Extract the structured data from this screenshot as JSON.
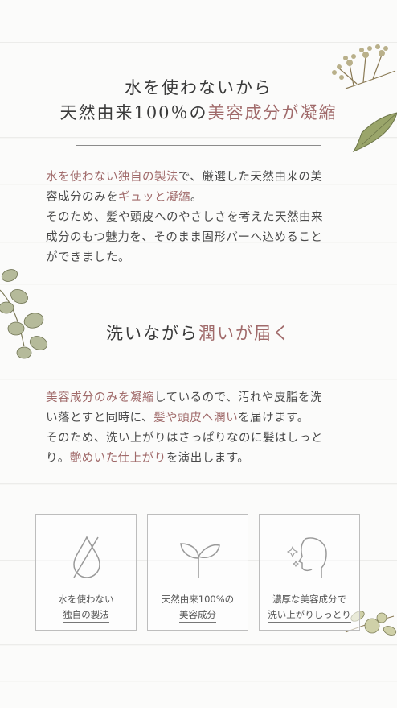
{
  "heading": {
    "line1": "水を使わないから",
    "line2_plain": "天然由来100％の",
    "line2_accent": "美容成分が凝縮"
  },
  "para1": [
    [
      {
        "t": "水を使わない独自の製法",
        "hl": true
      },
      {
        "t": "で、厳選した天然由来の美",
        "hl": false
      }
    ],
    [
      {
        "t": "容成分のみを",
        "hl": false
      },
      {
        "t": "ギュッと凝縮",
        "hl": true
      },
      {
        "t": "。",
        "hl": false
      }
    ],
    [
      {
        "t": "そのため、髪や頭皮へのやさしさを考えた天然由来",
        "hl": false
      }
    ],
    [
      {
        "t": "成分のもつ魅力を、そのまま固形バーへ込めること",
        "hl": false
      }
    ],
    [
      {
        "t": "ができました。",
        "hl": false
      }
    ]
  ],
  "heading2": {
    "plain": "洗いながら",
    "accent": "潤いが届く"
  },
  "para2": [
    [
      {
        "t": "美容成分のみを凝縮",
        "hl": true
      },
      {
        "t": "しているので、汚れや皮脂を洗",
        "hl": false
      }
    ],
    [
      {
        "t": "い落とすと同時に、",
        "hl": false
      },
      {
        "t": "髪や頭皮へ潤い",
        "hl": true
      },
      {
        "t": "を届けます。",
        "hl": false
      }
    ],
    [
      {
        "t": "そのため、洗い上がりはさっぱりなのに髪はしっと",
        "hl": false
      }
    ],
    [
      {
        "t": "り。",
        "hl": false
      },
      {
        "t": "艶めいた仕上がり",
        "hl": true
      },
      {
        "t": "を演出します。",
        "hl": false
      }
    ]
  ],
  "cards": [
    {
      "icon": "no-water-drop-icon",
      "line1": "水を使わない",
      "line2": "独自の製法"
    },
    {
      "icon": "sprout-icon",
      "line1": "天然由来100%の",
      "line2": "美容成分"
    },
    {
      "icon": "face-sparkle-icon",
      "line1": "濃厚な美容成分で",
      "line2": "洗い上がりしっとり"
    }
  ],
  "colors": {
    "accent": "#a06a6a",
    "text": "#3a3a3a",
    "border": "#bdbdbd"
  }
}
